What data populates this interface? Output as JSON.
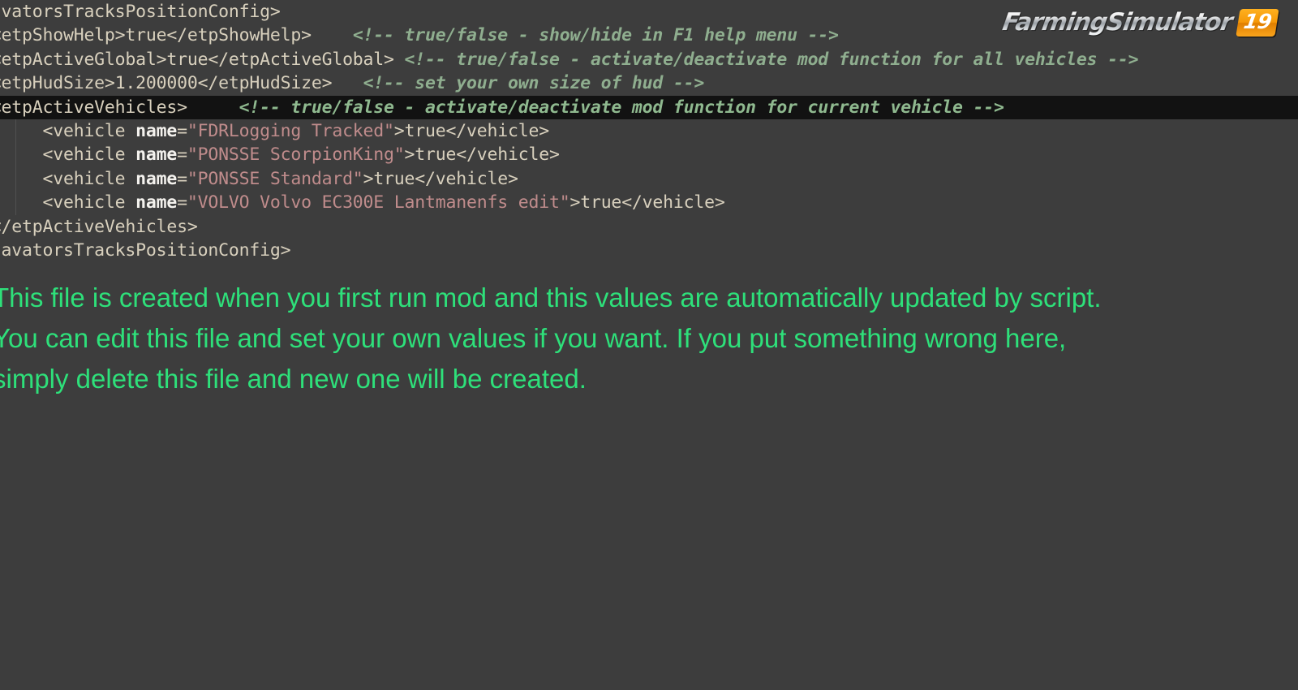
{
  "app": {
    "title": "Farming Simulator 19",
    "logo": {
      "word": "FarmingSimulator",
      "version_badge": "19",
      "badge_color": "#f59808",
      "word_color": "#dfe2e4"
    }
  },
  "theme": {
    "background": "#3d3d3d",
    "highlight_row_background": "#121212",
    "tag_color": "#d8d0bd",
    "attribute_color": "#f4f2ee",
    "attribute_value_color": "#c08c8c",
    "comment_color": "#8fae8f",
    "note_color": "#2ee07a"
  },
  "editor": {
    "name": "xml-config-editor",
    "file_type": "xml",
    "horizontally_scrolled": true,
    "highlighted_line_index": 4,
    "lines": [
      {
        "index": 0,
        "highlighted": false,
        "tokens": [
          {
            "type": "tag",
            "text": "cavatorsTracksPositionConfig>"
          }
        ]
      },
      {
        "index": 1,
        "highlighted": false,
        "tokens": [
          {
            "type": "tag",
            "text": " <etpShowHelp>"
          },
          {
            "type": "text",
            "text": "true"
          },
          {
            "type": "tag",
            "text": "</etpShowHelp>"
          },
          {
            "type": "text",
            "text": "    "
          },
          {
            "type": "comment",
            "text": "<!-- true/false - show/hide in F1 help menu -->"
          }
        ]
      },
      {
        "index": 2,
        "highlighted": false,
        "tokens": [
          {
            "type": "tag",
            "text": " <etpActiveGlobal>"
          },
          {
            "type": "text",
            "text": "true"
          },
          {
            "type": "tag",
            "text": "</etpActiveGlobal>"
          },
          {
            "type": "text",
            "text": " "
          },
          {
            "type": "comment",
            "text": "<!-- true/false - activate/deactivate mod function for all vehicles -->"
          }
        ]
      },
      {
        "index": 3,
        "highlighted": false,
        "tokens": [
          {
            "type": "tag",
            "text": " <etpHudSize>"
          },
          {
            "type": "text",
            "text": "1.200000"
          },
          {
            "type": "tag",
            "text": "</etpHudSize>"
          },
          {
            "type": "text",
            "text": "   "
          },
          {
            "type": "comment",
            "text": "<!-- set your own size of hud -->"
          }
        ]
      },
      {
        "index": 4,
        "highlighted": true,
        "tokens": [
          {
            "type": "tag",
            "text": " <etpActiveVehicles>"
          },
          {
            "type": "text",
            "text": "     "
          },
          {
            "type": "comment",
            "text": "<!-- true/false - activate/deactivate mod function for current vehicle -->"
          }
        ]
      },
      {
        "index": 5,
        "highlighted": false,
        "tokens": [
          {
            "type": "tag",
            "text": "      <vehicle "
          },
          {
            "type": "attr",
            "text": "name"
          },
          {
            "type": "tag",
            "text": "="
          },
          {
            "type": "val",
            "text": "\"FDRLogging Tracked\""
          },
          {
            "type": "tag",
            "text": ">"
          },
          {
            "type": "text",
            "text": "true"
          },
          {
            "type": "tag",
            "text": "</vehicle>"
          }
        ]
      },
      {
        "index": 6,
        "highlighted": false,
        "tokens": [
          {
            "type": "tag",
            "text": "      <vehicle "
          },
          {
            "type": "attr",
            "text": "name"
          },
          {
            "type": "tag",
            "text": "="
          },
          {
            "type": "val",
            "text": "\"PONSSE ScorpionKing\""
          },
          {
            "type": "tag",
            "text": ">"
          },
          {
            "type": "text",
            "text": "true"
          },
          {
            "type": "tag",
            "text": "</vehicle>"
          }
        ]
      },
      {
        "index": 7,
        "highlighted": false,
        "tokens": [
          {
            "type": "tag",
            "text": "      <vehicle "
          },
          {
            "type": "attr",
            "text": "name"
          },
          {
            "type": "tag",
            "text": "="
          },
          {
            "type": "val",
            "text": "\"PONSSE Standard\""
          },
          {
            "type": "tag",
            "text": ">"
          },
          {
            "type": "text",
            "text": "true"
          },
          {
            "type": "tag",
            "text": "</vehicle>"
          }
        ]
      },
      {
        "index": 8,
        "highlighted": false,
        "tokens": [
          {
            "type": "tag",
            "text": "      <vehicle "
          },
          {
            "type": "attr",
            "text": "name"
          },
          {
            "type": "tag",
            "text": "="
          },
          {
            "type": "val",
            "text": "\"VOLVO Volvo EC300E Lantmanenfs edit\""
          },
          {
            "type": "tag",
            "text": ">"
          },
          {
            "type": "text",
            "text": "true"
          },
          {
            "type": "tag",
            "text": "</vehicle>"
          }
        ]
      },
      {
        "index": 9,
        "highlighted": false,
        "tokens": [
          {
            "type": "tag",
            "text": " </etpActiveVehicles>"
          }
        ]
      },
      {
        "index": 10,
        "highlighted": false,
        "tokens": [
          {
            "type": "tag",
            "text": "xcavatorsTracksPositionConfig>"
          }
        ]
      }
    ]
  },
  "note": {
    "name": "config-file-instructions",
    "lines": [
      "This file is created when you first run mod and this values are automatically updated by script.",
      "You can edit this file and set your own values if you want. If you put something wrong here,",
      "simply delete this file and new one will be created."
    ]
  }
}
